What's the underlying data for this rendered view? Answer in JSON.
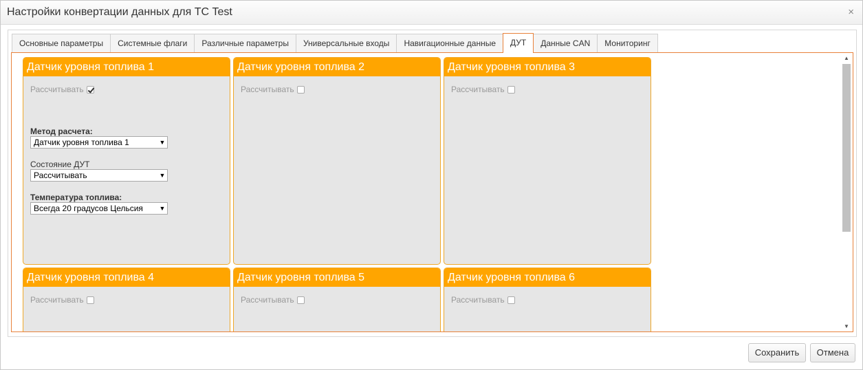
{
  "dialog": {
    "title": "Настройки конвертации данных для ТС Test",
    "close_glyph": "×"
  },
  "tabs": [
    {
      "label": "Основные параметры"
    },
    {
      "label": "Системные флаги"
    },
    {
      "label": "Различные параметры"
    },
    {
      "label": "Универсальные входы"
    },
    {
      "label": "Навигационные данные"
    },
    {
      "label": "ДУТ",
      "active": true
    },
    {
      "label": "Данные CAN"
    },
    {
      "label": "Мониторинг"
    }
  ],
  "panels": [
    {
      "title": "Датчик уровня топлива 1",
      "calc_label": "Рассчитывать",
      "calc_checked": true,
      "method_label": "Метод расчета:",
      "method_value": "Датчик уровня топлива 1",
      "state_label": "Состояние ДУТ",
      "state_value": "Рассчитывать",
      "temp_label": "Температура топлива:",
      "temp_value": "Всегда 20 градусов Цельсия"
    },
    {
      "title": "Датчик уровня топлива 2",
      "calc_label": "Рассчитывать",
      "calc_checked": false
    },
    {
      "title": "Датчик уровня топлива 3",
      "calc_label": "Рассчитывать",
      "calc_checked": false
    },
    {
      "title": "Датчик уровня топлива 4",
      "calc_label": "Рассчитывать",
      "calc_checked": false
    },
    {
      "title": "Датчик уровня топлива 5",
      "calc_label": "Рассчитывать",
      "calc_checked": false
    },
    {
      "title": "Датчик уровня топлива 6",
      "calc_label": "Рассчитывать",
      "calc_checked": false
    }
  ],
  "footer": {
    "save_label": "Сохранить",
    "cancel_label": "Отмена"
  },
  "colors": {
    "panel_header": "#ffa500",
    "panel_body": "#e6e6e6",
    "active_border": "#e8813a"
  },
  "icons": {
    "close": "close-icon",
    "dropdown": "chevron-down-icon",
    "scroll_up": "scroll-up-icon",
    "scroll_down": "scroll-down-icon"
  }
}
